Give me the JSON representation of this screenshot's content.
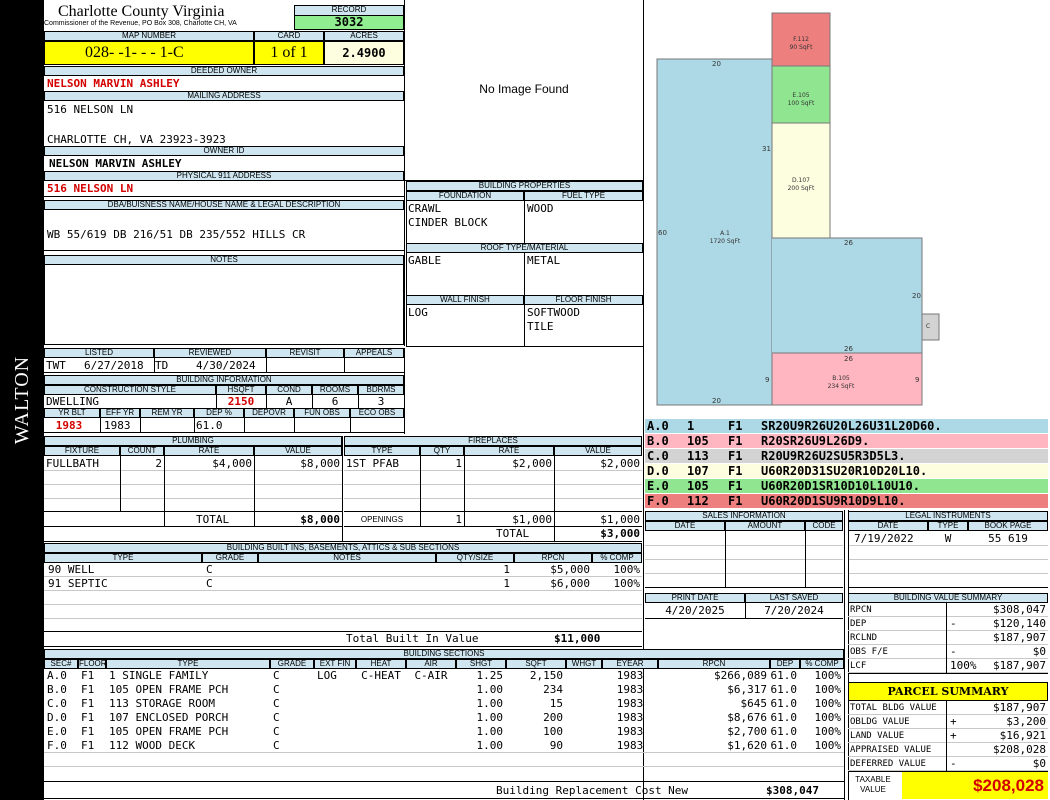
{
  "district": "WALTON",
  "header": {
    "county": "Charlotte County Virginia",
    "commissioner": "Commissioner of the Revenue, PO Box 308, Charlotte CH, VA",
    "record_label": "RECORD",
    "record": "3032"
  },
  "map": {
    "label": "MAP NUMBER",
    "value": "028- -1- - - 1-C",
    "card_label": "CARD",
    "card": "1 of 1",
    "acres_label": "ACRES",
    "acres": "2.4900"
  },
  "owner": {
    "deeded_label": "DEEDED OWNER",
    "deeded": "NELSON MARVIN ASHLEY",
    "mailing_label": "MAILING ADDRESS",
    "addr1": "516 NELSON LN",
    "addr2": "CHARLOTTE CH, VA 23923-3923",
    "owner_id_label": "OWNER ID",
    "owner_id_name": "NELSON MARVIN ASHLEY",
    "phys_label": "PHYSICAL 911 ADDRESS",
    "phys": "516 NELSON LN"
  },
  "legal": {
    "label": "DBA/BUISNESS NAME/HOUSE NAME & LEGAL DESCRIPTION",
    "text": "WB 55/619 DB 216/51 DB 235/552 HILLS CR"
  },
  "notes": {
    "label": "NOTES"
  },
  "image": {
    "placeholder": "No Image Found"
  },
  "props": {
    "title": "BUILDING PROPERTIES",
    "foundation_label": "FOUNDATION",
    "foundation": [
      "CRAWL",
      "CINDER BLOCK"
    ],
    "fuel_label": "FUEL TYPE",
    "fuel": "WOOD",
    "roof_label": "ROOF TYPE/MATERIAL",
    "roof_type": "GABLE",
    "roof_material": "METAL",
    "wall_label": "WALL FINISH",
    "wall": "LOG",
    "floor_label": "FLOOR FINISH",
    "floor": [
      "SOFTWOOD",
      "TILE"
    ]
  },
  "status": {
    "listed_label": "LISTED",
    "listed_by": "TWT",
    "listed_date": "6/27/2018",
    "reviewed_label": "REVIEWED",
    "reviewed_by": "TD",
    "reviewed_date": "4/30/2024",
    "revisit_label": "REVISIT",
    "appeals_label": "APPEALS"
  },
  "bldg_info": {
    "title": "BUILDING INFORMATION",
    "style_label": "CONSTRUCTION STYLE",
    "style": "DWELLING",
    "hsqft_label": "HSQFT",
    "hsqft": "2150",
    "cond_label": "COND",
    "cond": "A",
    "rooms_label": "ROOMS",
    "rooms": "6",
    "bdrms_label": "BDRMS",
    "bdrms": "3",
    "yrblt_label": "YR BLT",
    "yrblt": "1983",
    "effyr_label": "EFF YR",
    "effyr": "1983",
    "remyr_label": "REM YR",
    "remyr": "",
    "dep_label": "DEP %",
    "dep": "61.0",
    "depovr_label": "DEPOVR",
    "funobs_label": "FUN OBS",
    "ecoobs_label": "ECO OBS"
  },
  "plumbing": {
    "title": "PLUMBING",
    "headers": [
      "FIXTURE",
      "COUNT",
      "RATE",
      "VALUE"
    ],
    "rows": [
      [
        "FULLBATH",
        "2",
        "$4,000",
        "$8,000"
      ]
    ],
    "total_label": "TOTAL",
    "total": "$8,000"
  },
  "fireplaces": {
    "title": "FIREPLACES",
    "headers": [
      "TYPE",
      "QTY",
      "RATE",
      "VALUE"
    ],
    "rows": [
      [
        "1ST PFAB",
        "1",
        "$2,000",
        "$2,000"
      ]
    ],
    "openings_label": "OPENINGS",
    "openings": [
      "1",
      "$1,000",
      "$1,000"
    ],
    "total_label": "TOTAL",
    "total": "$3,000"
  },
  "builtins": {
    "title": "BUILDING BUILT INS, BASEMENTS, ATTICS & SUB SECTIONS",
    "headers": [
      "TYPE",
      "GRADE",
      "NOTES",
      "QTY/SIZE",
      "RPCN",
      "% COMP"
    ],
    "rows": [
      [
        "90 WELL",
        "C",
        "",
        "1",
        "$5,000",
        "100%"
      ],
      [
        "91 SEPTIC",
        "C",
        "",
        "1",
        "$6,000",
        "100%"
      ]
    ],
    "total_label": "Total Built In Value",
    "total": "$11,000"
  },
  "sections": {
    "title": "BUILDING SECTIONS",
    "headers": [
      "SEC#",
      "FLOOR",
      "TYPE",
      "GRADE",
      "EXT FIN",
      "HEAT",
      "AIR",
      "SHGT",
      "SQFT",
      "WHGT",
      "EYEAR",
      "RPCN",
      "DEP",
      "% COMP"
    ],
    "rows": [
      [
        "A.0",
        "F1",
        "1 SINGLE FAMILY",
        "C",
        "LOG",
        "C-HEAT",
        "C-AIR",
        "1.25",
        "2,150",
        "",
        "1983",
        "$266,089",
        "61.0",
        "100%"
      ],
      [
        "B.0",
        "F1",
        "105 OPEN FRAME PCH",
        "C",
        "",
        "",
        "",
        "1.00",
        "234",
        "",
        "1983",
        "$6,317",
        "61.0",
        "100%"
      ],
      [
        "C.0",
        "F1",
        "113 STORAGE ROOM",
        "C",
        "",
        "",
        "",
        "1.00",
        "15",
        "",
        "1983",
        "$645",
        "61.0",
        "100%"
      ],
      [
        "D.0",
        "F1",
        "107 ENCLOSED PORCH",
        "C",
        "",
        "",
        "",
        "1.00",
        "200",
        "",
        "1983",
        "$8,676",
        "61.0",
        "100%"
      ],
      [
        "E.0",
        "F1",
        "105 OPEN FRAME PCH",
        "C",
        "",
        "",
        "",
        "1.00",
        "100",
        "",
        "1983",
        "$2,700",
        "61.0",
        "100%"
      ],
      [
        "F.0",
        "F1",
        "112 WOOD DECK",
        "C",
        "",
        "",
        "",
        "1.00",
        "90",
        "",
        "1983",
        "$1,620",
        "61.0",
        "100%"
      ]
    ],
    "total_label": "Building Replacement Cost New",
    "total": "$308,047"
  },
  "sketch": {
    "areas": [
      {
        "id": "F.112",
        "sqft": "90 SqFt",
        "color": "#ee7f7f"
      },
      {
        "id": "E.105",
        "sqft": "100 SqFt",
        "color": "#90e690"
      },
      {
        "id": "D.107",
        "sqft": "200 SqFt",
        "color": "#fdfde0"
      },
      {
        "id": "A.1",
        "sqft": "1720 SqFt",
        "color": "#add8e6"
      },
      {
        "id": "B.105",
        "sqft": "234 SqFt",
        "color": "#ffb6c1"
      },
      {
        "id": "C",
        "sqft": "",
        "color": "#d3d3d3"
      }
    ],
    "dims": [
      "20",
      "31",
      "60",
      "26",
      "20",
      "26",
      "26",
      "9",
      "9",
      "20"
    ],
    "legend": [
      {
        "sec": "A.0",
        "code": "1",
        "floor": "F1",
        "vectors": "SR20U9R26U20L26U31L20D60.",
        "color": "#add8e6"
      },
      {
        "sec": "B.0",
        "code": "105",
        "floor": "F1",
        "vectors": "R20SR26U9L26D9.",
        "color": "#ffb6c1"
      },
      {
        "sec": "C.0",
        "code": "113",
        "floor": "F1",
        "vectors": "R20U9R26U2SU5R3D5L3.",
        "color": "#d3d3d3"
      },
      {
        "sec": "D.0",
        "code": "107",
        "floor": "F1",
        "vectors": "U60R20D31SU20R10D20L10.",
        "color": "#fdfde0"
      },
      {
        "sec": "E.0",
        "code": "105",
        "floor": "F1",
        "vectors": "U60R20D1SR10D10L10U10.",
        "color": "#90e690"
      },
      {
        "sec": "F.0",
        "code": "112",
        "floor": "F1",
        "vectors": "U60R20D1SU9R10D9L10.",
        "color": "#ee7f7f"
      }
    ]
  },
  "sales": {
    "title": "SALES INFORMATION",
    "headers": [
      "DATE",
      "AMOUNT",
      "CODE"
    ]
  },
  "legal_instr": {
    "title": "LEGAL INSTRUMENTS",
    "headers": [
      "DATE",
      "TYPE",
      "BOOK PAGE"
    ],
    "rows": [
      [
        "7/19/2022",
        "W",
        "55 619"
      ]
    ]
  },
  "dates": {
    "print_label": "PRINT DATE",
    "print": "4/20/2025",
    "saved_label": "LAST SAVED",
    "saved": "7/20/2024"
  },
  "value_summary": {
    "title": "BUILDING VALUE SUMMARY",
    "rows": [
      [
        "RPCN",
        "",
        "$308,047"
      ],
      [
        "DEP",
        "-",
        "$120,140"
      ],
      [
        "RCLND",
        "",
        "$187,907"
      ],
      [
        "OBS F/E",
        "-",
        "$0"
      ],
      [
        "LCF",
        "100%",
        "$187,907"
      ]
    ]
  },
  "parcel": {
    "title": "PARCEL SUMMARY",
    "rows": [
      [
        "TOTAL BLDG VALUE",
        "",
        "$187,907"
      ],
      [
        "OBLDG VALUE",
        "+",
        "$3,200"
      ],
      [
        "LAND VALUE",
        "+",
        "$16,921"
      ],
      [
        "APPRAISED VALUE",
        "",
        "$208,028"
      ],
      [
        "DEFERRED VALUE",
        "-",
        "$0"
      ]
    ],
    "taxable_label1": "TAXABLE",
    "taxable_label2": "VALUE",
    "taxable": "$208,028"
  },
  "colors": {
    "header": "#cfe6f0",
    "yellow": "#ffff00",
    "green": "#90ee90",
    "red": "#d40000"
  }
}
